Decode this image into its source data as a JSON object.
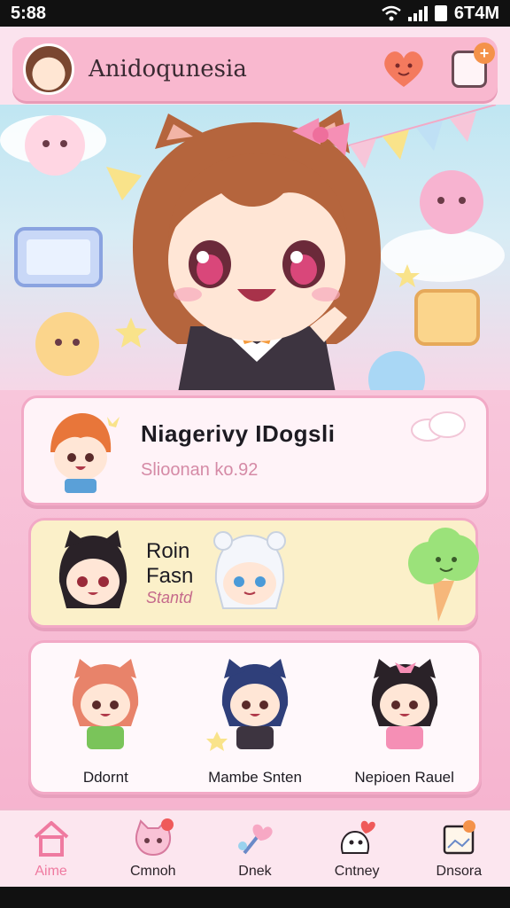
{
  "status_bar": {
    "time": "5:88",
    "right_text": "6T4M"
  },
  "header": {
    "title": "Anidoqunesia",
    "badge": "+"
  },
  "profile": {
    "name": "Niagerivy IDogsli",
    "subtitle": "Slioonan ko.92"
  },
  "friend": {
    "line1": "Roin",
    "line2": "Fasn",
    "line3": "Stantd"
  },
  "characters": [
    {
      "name": "Ddornt"
    },
    {
      "name": "Mambe Snten"
    },
    {
      "name": "Nepioen Rauel"
    }
  ],
  "nav": {
    "items": [
      {
        "label": "Aime",
        "icon": "home-icon"
      },
      {
        "label": "Cmnoh",
        "icon": "cat-face-icon"
      },
      {
        "label": "Dnek",
        "icon": "heart-wand-icon"
      },
      {
        "label": "Cntney",
        "icon": "ghost-heart-icon"
      },
      {
        "label": "Dnsora",
        "icon": "photo-frame-icon"
      }
    ]
  },
  "colors": {
    "accent_pink": "#f9b8cf",
    "active_nav": "#ef7aa0",
    "card_yellow": "#fbf0c9",
    "status_bar": "#111111"
  }
}
